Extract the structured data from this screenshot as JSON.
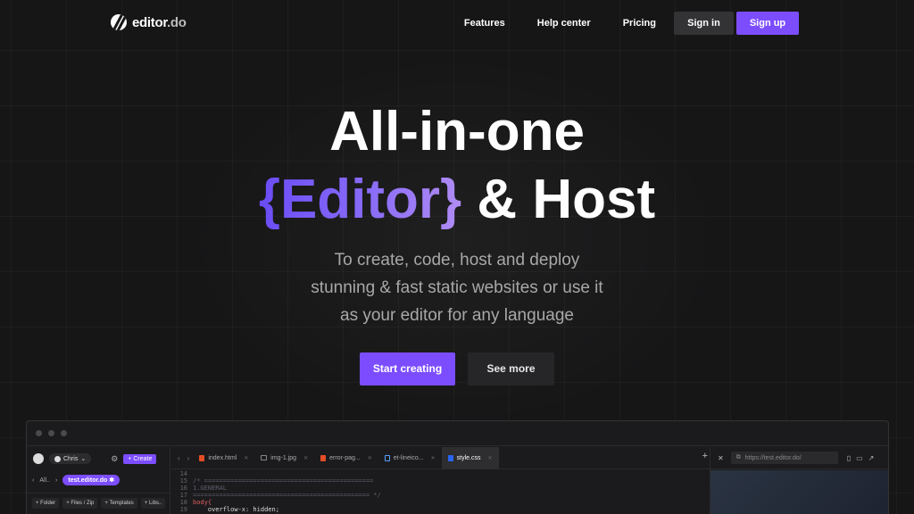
{
  "nav": {
    "logo_name": "editor",
    "logo_tld": ".do",
    "links": [
      "Features",
      "Help center",
      "Pricing"
    ],
    "signin_label": "Sign in",
    "signup_label": "Sign up"
  },
  "hero": {
    "line1": "All-in-one",
    "line2_highlight": "{Editor}",
    "line2_rest": " & Host",
    "subtitle_1": "To create, code, host and deploy",
    "subtitle_2": "stunning & fast static websites or use it",
    "subtitle_3": "as your editor for any language",
    "cta_primary": "Start creating",
    "cta_secondary": "See more"
  },
  "colors": {
    "accent": "#7c4dff",
    "background": "#161617"
  },
  "editor": {
    "sidebar": {
      "user": "Chris",
      "create_label": "+ Create",
      "back_label": "All..",
      "domain": "test.editor.do",
      "buttons": [
        "+ Folder",
        "+ Files / Zip",
        "+ Templates",
        "+ Libs.."
      ]
    },
    "tabs": [
      {
        "label": "index.html",
        "icon": "html-file-icon"
      },
      {
        "label": "img-1.jpg",
        "icon": "image-file-icon"
      },
      {
        "label": "error-pag...",
        "icon": "html-file-icon"
      },
      {
        "label": "et-lineico...",
        "icon": "font-file-icon"
      },
      {
        "label": "style.css",
        "icon": "css-file-icon",
        "active": true
      }
    ],
    "code": [
      {
        "n": "14",
        "text": ""
      },
      {
        "n": "15",
        "text": "/* ============================================="
      },
      {
        "n": "16",
        "text": "1.GENERAL"
      },
      {
        "n": "17",
        "text": "=============================================== */"
      },
      {
        "n": "18",
        "text": "body{"
      },
      {
        "n": "19",
        "text": "    overflow-x: hidden;"
      }
    ],
    "preview_url": "https://test.editor.do/"
  }
}
